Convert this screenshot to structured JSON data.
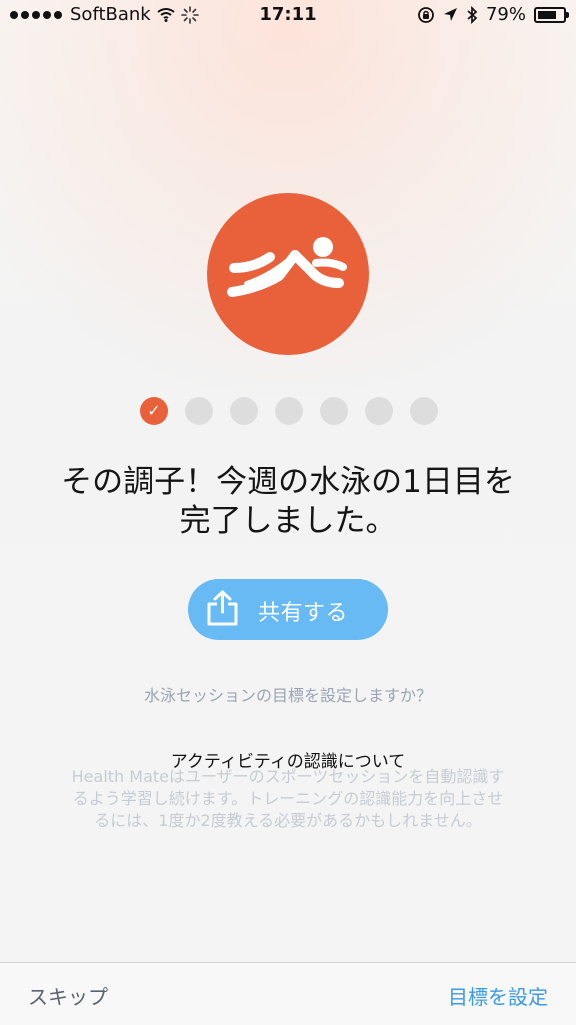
{
  "status_bar": {
    "carrier": "SoftBank",
    "time": "17:11",
    "battery": "79%",
    "icons": [
      "signal-dots-icon",
      "wifi-icon",
      "loading-icon",
      "orientation-lock-icon",
      "location-icon",
      "bluetooth-icon",
      "battery-icon"
    ]
  },
  "activity": {
    "icon": "swimming-icon",
    "color": "#e9613a"
  },
  "progress": {
    "completed": 1,
    "total": 7
  },
  "headline": {
    "line1": "その調子！今週の水泳の1日目を",
    "line2": "完了しました。"
  },
  "share": {
    "label": "共有する",
    "icon": "share-icon",
    "color": "#67baf4"
  },
  "goal_question": "水泳セッションの目標を設定しますか？",
  "about": {
    "title": "アクティビティの認識について",
    "line1": "Health Mateはユーザーのスポーツセッションを自動認識す",
    "line2": "るよう学習し続けます。トレーニングの認識能力を向上させ",
    "line3": "るには、1度か2度教える必要があるかもしれません。"
  },
  "bottom_bar": {
    "skip_label": "スキップ",
    "set_goal_label": "目標を設定"
  }
}
